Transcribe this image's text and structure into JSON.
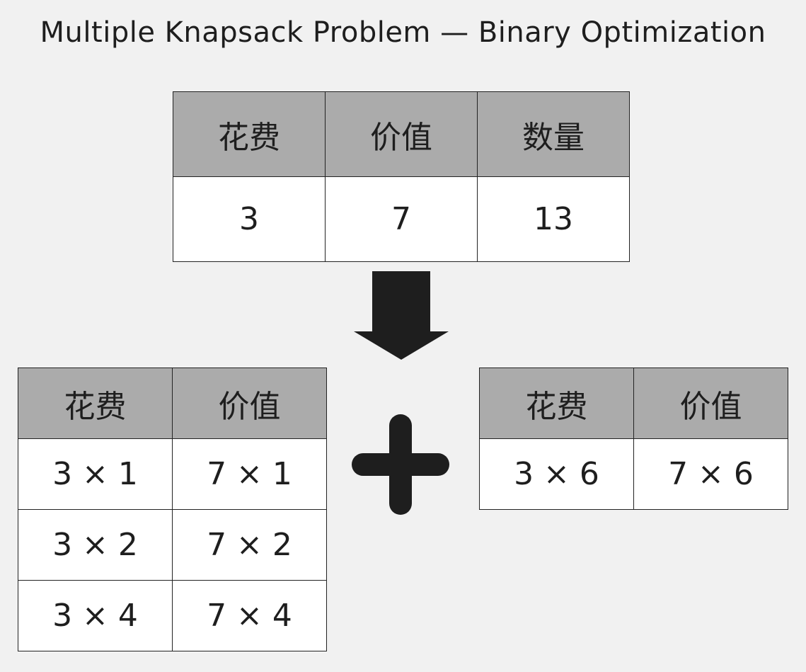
{
  "title": "Multiple Knapsack Problem — Binary Optimization",
  "top_table": {
    "headers": [
      "花费",
      "价值",
      "数量"
    ],
    "row": [
      "3",
      "7",
      "13"
    ]
  },
  "left_table": {
    "headers": [
      "花费",
      "价值"
    ],
    "rows": [
      [
        "3 × 1",
        "7 × 1"
      ],
      [
        "3 × 2",
        "7 × 2"
      ],
      [
        "3 × 4",
        "7 × 4"
      ]
    ]
  },
  "right_table": {
    "headers": [
      "花费",
      "价值"
    ],
    "rows": [
      [
        "3 × 6",
        "7 × 6"
      ]
    ]
  },
  "colors": {
    "background": "#f1f1f1",
    "header_fill": "#ababab",
    "cell_fill": "#ffffff",
    "border": "#222222",
    "glyph": "#1e1e1e"
  },
  "icons": {
    "arrow": "down-arrow-icon",
    "plus": "plus-icon"
  }
}
